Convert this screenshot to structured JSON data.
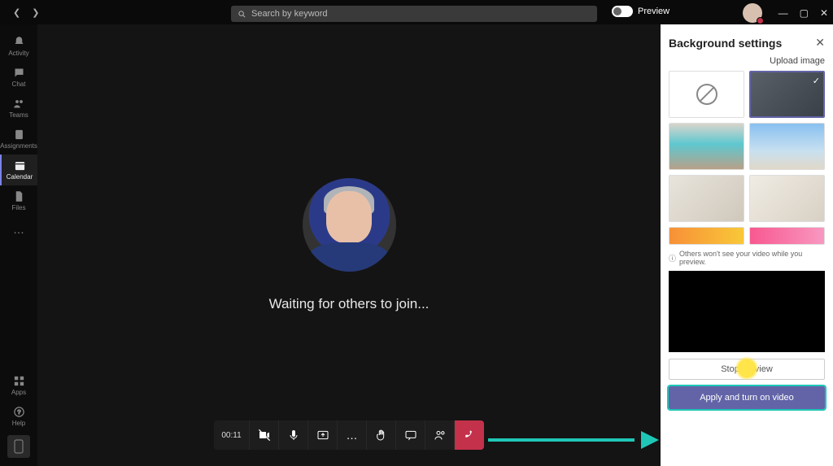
{
  "titlebar": {
    "search_placeholder": "Search by keyword",
    "preview_label": "Preview"
  },
  "sidebar": {
    "items": [
      {
        "label": "Activity"
      },
      {
        "label": "Chat"
      },
      {
        "label": "Teams"
      },
      {
        "label": "Assignments"
      },
      {
        "label": "Calendar"
      },
      {
        "label": "Files"
      }
    ],
    "bottom": [
      {
        "label": "Apps"
      },
      {
        "label": "Help"
      }
    ]
  },
  "meeting": {
    "status": "Waiting for others to join...",
    "elapsed": "00:11"
  },
  "panel": {
    "title": "Background settings",
    "upload": "Upload image",
    "info": "Others won't see your video while you preview.",
    "stop_preview": "Stop preview",
    "apply": "Apply and turn on video"
  }
}
